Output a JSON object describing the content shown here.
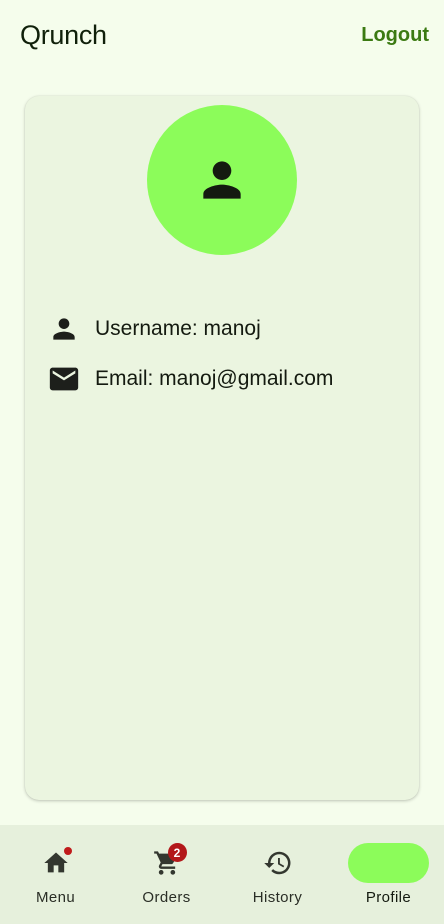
{
  "app_bar": {
    "title": "Qrunch",
    "logout_label": "Logout"
  },
  "profile": {
    "avatar_icon": "person-icon",
    "username_text": "Username: manoj",
    "email_text": "Email: manoj@gmail.com"
  },
  "bottom_nav": {
    "items": [
      {
        "label": "Menu",
        "icon": "home-icon"
      },
      {
        "label": "Orders",
        "icon": "cart-icon",
        "badge": "2"
      },
      {
        "label": "History",
        "icon": "history-icon"
      },
      {
        "label": "Profile",
        "icon": "person-icon",
        "active": true
      }
    ]
  },
  "colors": {
    "background": "#f5fdec",
    "accent": "#8cfc5a",
    "brand_text": "#3b7a12",
    "badge": "#b3181a"
  }
}
